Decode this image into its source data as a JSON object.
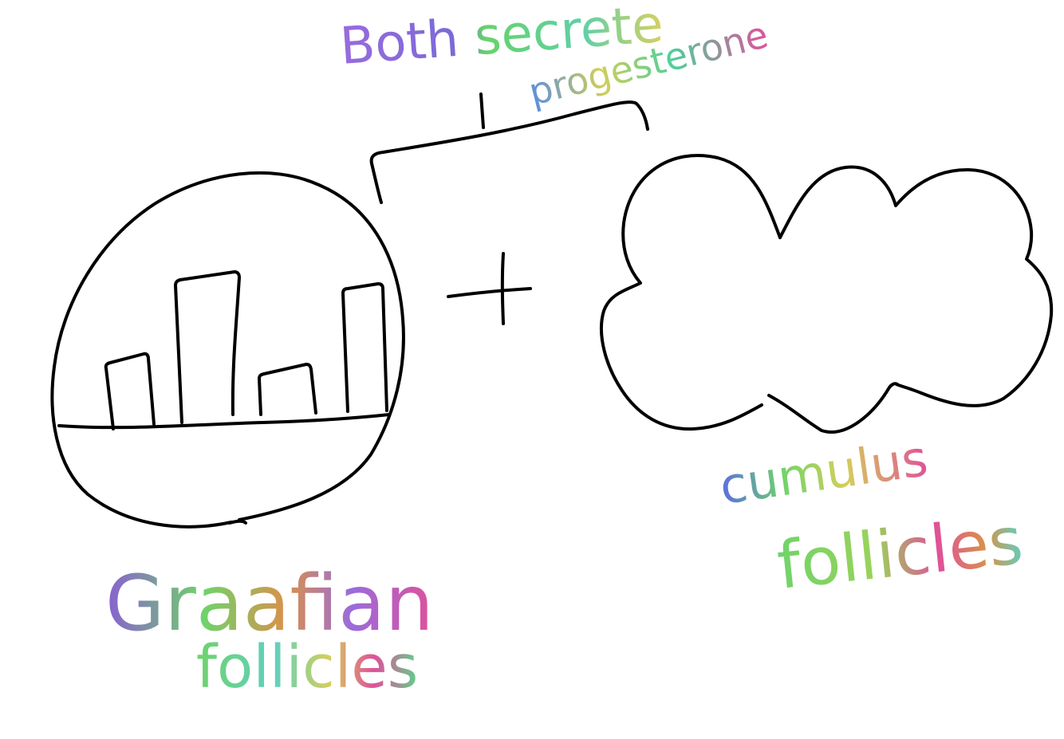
{
  "annotation": {
    "line1": "Both secrete",
    "line2": "progesterone"
  },
  "operator": "+",
  "left_item": {
    "line1": "Graafian",
    "line2": "follicles"
  },
  "right_item": {
    "line1": "cumulus",
    "line2": "follicles"
  },
  "colors": {
    "ink": "#000000",
    "purple": "#8a5fd1",
    "green": "#6fd36a",
    "blue": "#5a8ee0",
    "pink": "#e0509a",
    "yellow": "#d4cf5a",
    "orange": "#d9914a"
  }
}
